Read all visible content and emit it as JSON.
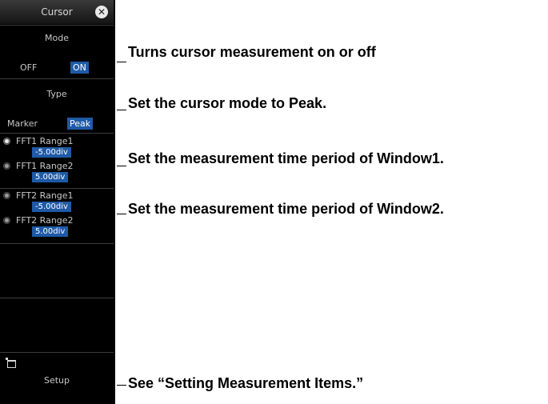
{
  "panel": {
    "title": "Cursor",
    "close_symbol": "✕",
    "mode": {
      "label": "Mode",
      "off": "OFF",
      "on": "ON",
      "selected": "ON"
    },
    "type": {
      "label": "Type",
      "marker": "Marker",
      "peak": "Peak",
      "selected": "Peak"
    },
    "ranges": [
      {
        "label": "FFT1 Range1",
        "value": "-5.00div",
        "selected": true
      },
      {
        "label": "FFT1 Range2",
        "value": "5.00div",
        "selected": false
      },
      {
        "label": "FFT2 Range1",
        "value": "-5.00div",
        "selected": false
      },
      {
        "label": "FFT2 Range2",
        "value": "5.00div",
        "selected": false
      }
    ],
    "setup": {
      "label": "Setup",
      "icon": "setup-icon"
    }
  },
  "callouts": [
    {
      "text": "Turns cursor measurement on or off"
    },
    {
      "text": "Set the cursor mode to Peak."
    },
    {
      "text": "Set the measurement time period of Window1."
    },
    {
      "text": "Set the measurement time period of Window2."
    },
    {
      "text": "See “Setting Measurement Items.”"
    }
  ],
  "colors": {
    "panel_bg": "#000000",
    "highlight": "#1f5aa6",
    "text": "#c8c8c8"
  }
}
